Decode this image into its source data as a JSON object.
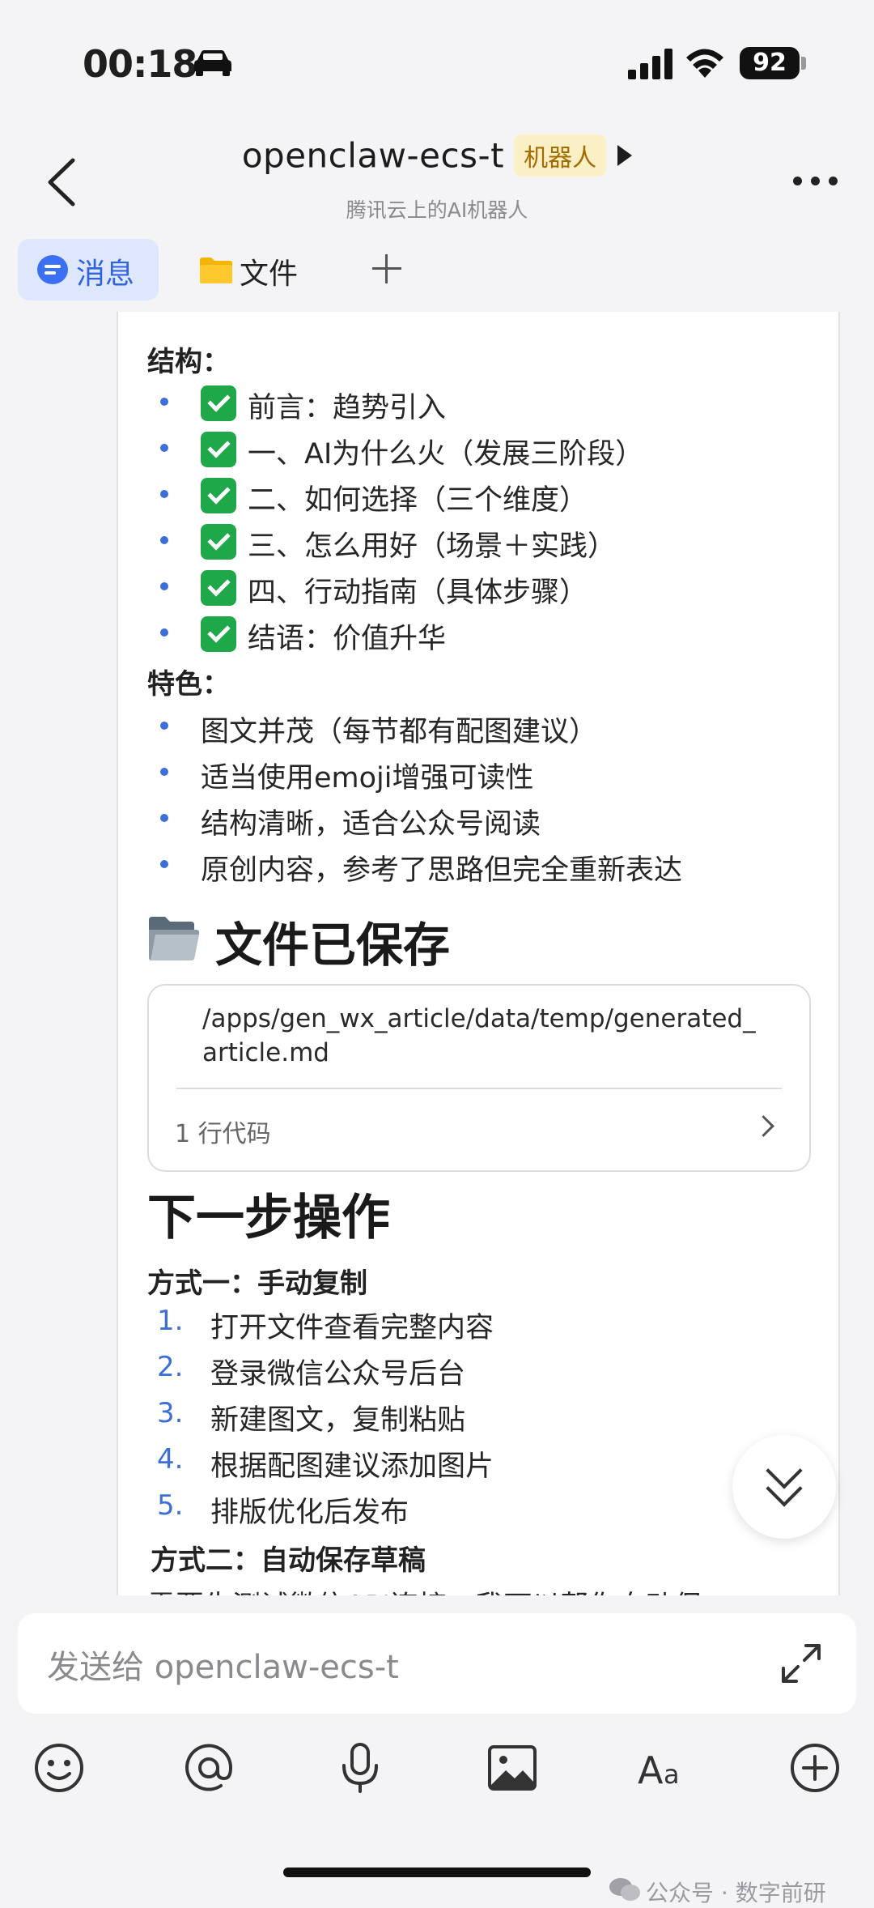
{
  "status_bar": {
    "time": "00:18",
    "battery": "92"
  },
  "header": {
    "title": "openclaw-ecs-t",
    "badge": "机器人",
    "subtitle": "腾讯云上的AI机器人"
  },
  "tabs": [
    {
      "label": "消息",
      "active": true
    },
    {
      "label": "文件",
      "active": false
    }
  ],
  "message": {
    "structure_label": "结构：",
    "structure_items": [
      "前言：趋势引入",
      "一、AI为什么火（发展三阶段）",
      "二、如何选择（三个维度）",
      "三、怎么用好（场景＋实践）",
      "四、行动指南（具体步骤）",
      "结语：价值升华"
    ],
    "features_label": "特色：",
    "features_items": [
      "图文并茂（每节都有配图建议）",
      "适当使用emoji增强可读性",
      "结构清晰，适合公众号阅读",
      "原创内容，参考了思路但完全重新表达"
    ],
    "file_heading": "文件已保存",
    "code_path": "/apps/gen_wx_article/data/temp/generated_article.md",
    "code_lines": "1 行代码",
    "next_heading": "下一步操作",
    "method1_label": "方式一：手动复制",
    "method1_steps": [
      "打开文件查看完整内容",
      "登录微信公众号后台",
      "新建图文，复制粘贴",
      "根据配图建议添加图片",
      "排版优化后发布"
    ],
    "method2_label": "方式二：自动保存草稿",
    "method2_text": "需要先测试微信API连接，我可以帮你自动保"
  },
  "composer": {
    "placeholder": "发送给 openclaw-ecs-t"
  },
  "watermark": "公众号 · 数字前研",
  "colors": {
    "accent": "#3c6fd8",
    "check_green": "#1fa84a",
    "badge_bg": "#fbefc6",
    "badge_text": "#a36c00"
  }
}
